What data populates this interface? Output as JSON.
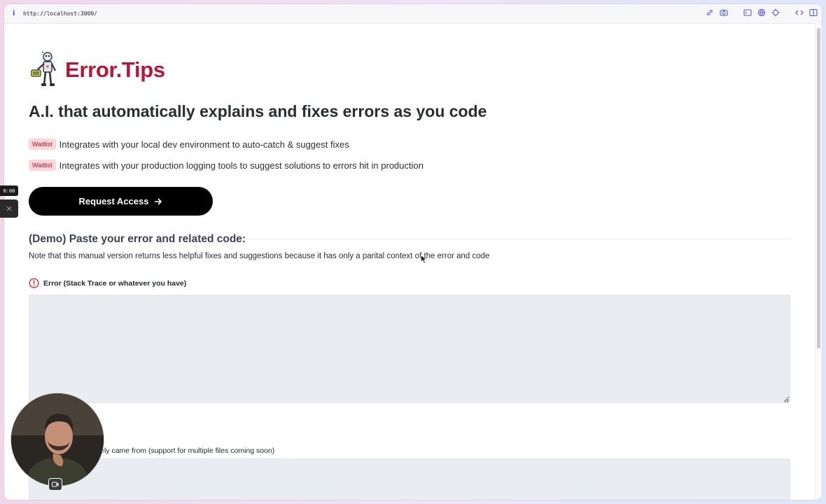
{
  "browser": {
    "url": "http://localhost:3000/",
    "info_icon": "i",
    "toolbar_icons": [
      "link-icon",
      "camera-icon",
      "terminal-icon",
      "globe-icon",
      "crosshair-icon",
      "code-icon",
      "sidebar-icon"
    ]
  },
  "brand": {
    "name": "Error.Tips",
    "logo_icon": "robot-icon",
    "color": "#b3183c"
  },
  "hero": {
    "headline": "A.I. that automatically explains and fixes errors as you code"
  },
  "features": [
    {
      "badge": "Waitlist",
      "text": "Integrates with your local dev environment to auto-catch & suggest fixes"
    },
    {
      "badge": "Waitlist",
      "text": "Integrates with your production logging tools to suggest solutions to errors hit in production"
    }
  ],
  "cta": {
    "label": "Request Access",
    "icon": "arrow-right-icon"
  },
  "demo": {
    "heading": "(Demo) Paste your error and related code:",
    "note": "Note that this manual version returns less helpful fixes and suggestions because it has only a parital context of the error and code",
    "error_label": "Error (Stack Trace or whatever you have)",
    "error_value": "",
    "code_label": "ere where the error likely came from (support for multiple files coming soon)",
    "code_value": ""
  },
  "recording": {
    "timer": "0:00",
    "close_icon": "close-icon",
    "camera_toggle_icon": "camera-toggle-icon"
  },
  "colors": {
    "badge_bg": "#fcd6da",
    "badge_text": "#9d1c2c",
    "textarea_bg": "#e9ecf0",
    "cta_bg": "#000000",
    "error_icon": "#d6303a"
  }
}
